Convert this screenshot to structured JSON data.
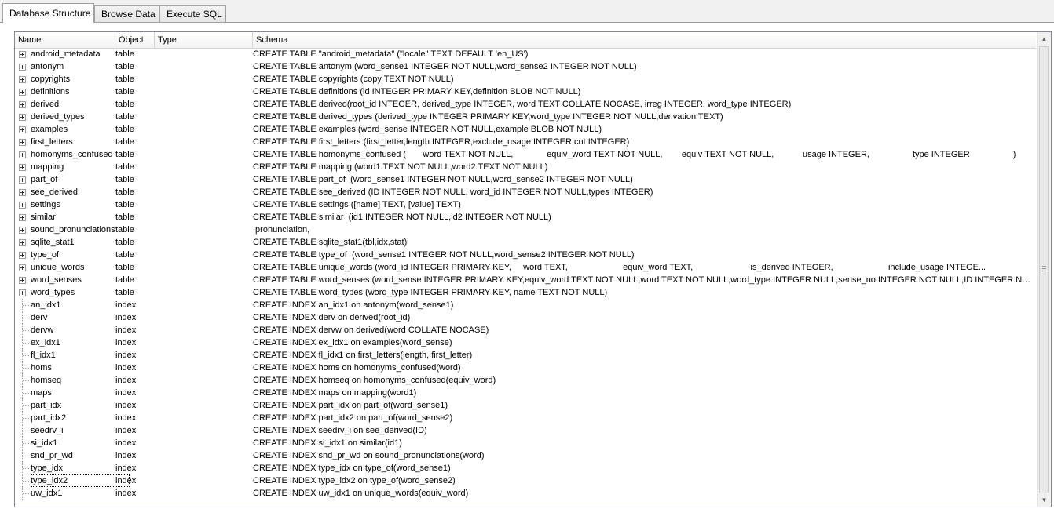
{
  "tabs": [
    {
      "label": "Database Structure",
      "active": true
    },
    {
      "label": "Browse Data",
      "active": false
    },
    {
      "label": "Execute SQL",
      "active": false
    }
  ],
  "columns": {
    "name": "Name",
    "object": "Object",
    "type": "Type",
    "schema": "Schema"
  },
  "rows": [
    {
      "name": "android_metadata",
      "object": "table",
      "type": "",
      "schema": "CREATE TABLE \"android_metadata\" (\"locale\" TEXT DEFAULT 'en_US')",
      "expandable": true
    },
    {
      "name": "antonym",
      "object": "table",
      "type": "",
      "schema": "CREATE TABLE antonym (word_sense1 INTEGER NOT NULL,word_sense2 INTEGER NOT NULL)",
      "expandable": true
    },
    {
      "name": "copyrights",
      "object": "table",
      "type": "",
      "schema": "CREATE TABLE copyrights (copy TEXT NOT NULL)",
      "expandable": true
    },
    {
      "name": "definitions",
      "object": "table",
      "type": "",
      "schema": "CREATE TABLE definitions (id INTEGER PRIMARY KEY,definition BLOB NOT NULL)",
      "expandable": true
    },
    {
      "name": "derived",
      "object": "table",
      "type": "",
      "schema": "CREATE TABLE derived(root_id INTEGER, derived_type INTEGER, word TEXT COLLATE NOCASE, irreg INTEGER, word_type INTEGER)",
      "expandable": true
    },
    {
      "name": "derived_types",
      "object": "table",
      "type": "",
      "schema": "CREATE TABLE derived_types (derived_type INTEGER PRIMARY KEY,word_type INTEGER NOT NULL,derivation TEXT)",
      "expandable": true
    },
    {
      "name": "examples",
      "object": "table",
      "type": "",
      "schema": "CREATE TABLE examples (word_sense INTEGER NOT NULL,example BLOB NOT NULL)",
      "expandable": true
    },
    {
      "name": "first_letters",
      "object": "table",
      "type": "",
      "schema": "CREATE TABLE first_letters (first_letter,length INTEGER,exclude_usage INTEGER,cnt INTEGER)",
      "expandable": true
    },
    {
      "name": "homonyms_confused",
      "object": "table",
      "type": "",
      "schema": "CREATE TABLE homonyms_confused (       word TEXT NOT NULL,              equiv_word TEXT NOT NULL,        equiv TEXT NOT NULL,            usage INTEGER,                  type INTEGER                  )",
      "expandable": true
    },
    {
      "name": "mapping",
      "object": "table",
      "type": "",
      "schema": "CREATE TABLE mapping (word1 TEXT NOT NULL,word2 TEXT NOT NULL)",
      "expandable": true
    },
    {
      "name": "part_of",
      "object": "table",
      "type": "",
      "schema": "CREATE TABLE part_of  (word_sense1 INTEGER NOT NULL,word_sense2 INTEGER NOT NULL)",
      "expandable": true
    },
    {
      "name": "see_derived",
      "object": "table",
      "type": "",
      "schema": "CREATE TABLE see_derived (ID INTEGER NOT NULL, word_id INTEGER NOT NULL,types INTEGER)",
      "expandable": true
    },
    {
      "name": "settings",
      "object": "table",
      "type": "",
      "schema": "CREATE TABLE settings ([name] TEXT, [value] TEXT)",
      "expandable": true
    },
    {
      "name": "similar",
      "object": "table",
      "type": "",
      "schema": "CREATE TABLE similar  (id1 INTEGER NOT NULL,id2 INTEGER NOT NULL)",
      "expandable": true
    },
    {
      "name": "sound_pronunciations",
      "object": "table",
      "type": "",
      "schema": " pronunciation,",
      "expandable": true
    },
    {
      "name": "sqlite_stat1",
      "object": "table",
      "type": "",
      "schema": "CREATE TABLE sqlite_stat1(tbl,idx,stat)",
      "expandable": true
    },
    {
      "name": "type_of",
      "object": "table",
      "type": "",
      "schema": "CREATE TABLE type_of  (word_sense1 INTEGER NOT NULL,word_sense2 INTEGER NOT NULL)",
      "expandable": true
    },
    {
      "name": "unique_words",
      "object": "table",
      "type": "",
      "schema": "CREATE TABLE unique_words (word_id INTEGER PRIMARY KEY,     word TEXT,                       equiv_word TEXT,                        is_derived INTEGER,                       include_usage INTEGE...",
      "expandable": true
    },
    {
      "name": "word_senses",
      "object": "table",
      "type": "",
      "schema": "CREATE TABLE word_senses (word_sense INTEGER PRIMARY KEY,equiv_word TEXT NOT NULL,word TEXT NOT NULL,word_type INTEGER NULL,sense_no INTEGER NOT NULL,ID INTEGER NOT ...",
      "expandable": true
    },
    {
      "name": "word_types",
      "object": "table",
      "type": "",
      "schema": "CREATE TABLE word_types (word_type INTEGER PRIMARY KEY, name TEXT NOT NULL)",
      "expandable": true
    },
    {
      "name": "an_idx1",
      "object": "index",
      "type": "",
      "schema": "CREATE INDEX an_idx1 on antonym(word_sense1)",
      "expandable": false
    },
    {
      "name": "derv",
      "object": "index",
      "type": "",
      "schema": "CREATE INDEX derv on derived(root_id)",
      "expandable": false
    },
    {
      "name": "dervw",
      "object": "index",
      "type": "",
      "schema": "CREATE INDEX dervw on derived(word COLLATE NOCASE)",
      "expandable": false
    },
    {
      "name": "ex_idx1",
      "object": "index",
      "type": "",
      "schema": "CREATE INDEX ex_idx1 on examples(word_sense)",
      "expandable": false
    },
    {
      "name": "fl_idx1",
      "object": "index",
      "type": "",
      "schema": "CREATE INDEX fl_idx1 on first_letters(length, first_letter)",
      "expandable": false
    },
    {
      "name": "homs",
      "object": "index",
      "type": "",
      "schema": "CREATE INDEX homs on homonyms_confused(word)",
      "expandable": false
    },
    {
      "name": "homseq",
      "object": "index",
      "type": "",
      "schema": "CREATE INDEX homseq on homonyms_confused(equiv_word)",
      "expandable": false
    },
    {
      "name": "maps",
      "object": "index",
      "type": "",
      "schema": "CREATE INDEX maps on mapping(word1)",
      "expandable": false
    },
    {
      "name": "part_idx",
      "object": "index",
      "type": "",
      "schema": "CREATE INDEX part_idx on part_of(word_sense1)",
      "expandable": false
    },
    {
      "name": "part_idx2",
      "object": "index",
      "type": "",
      "schema": "CREATE INDEX part_idx2 on part_of(word_sense2)",
      "expandable": false
    },
    {
      "name": "seedrv_i",
      "object": "index",
      "type": "",
      "schema": "CREATE INDEX seedrv_i on see_derived(ID)",
      "expandable": false
    },
    {
      "name": "si_idx1",
      "object": "index",
      "type": "",
      "schema": "CREATE INDEX si_idx1 on similar(id1)",
      "expandable": false
    },
    {
      "name": "snd_pr_wd",
      "object": "index",
      "type": "",
      "schema": "CREATE INDEX snd_pr_wd on sound_pronunciations(word)",
      "expandable": false
    },
    {
      "name": "type_idx",
      "object": "index",
      "type": "",
      "schema": "CREATE INDEX type_idx on type_of(word_sense1)",
      "expandable": false
    },
    {
      "name": "type_idx2",
      "object": "index",
      "type": "",
      "schema": "CREATE INDEX type_idx2 on type_of(word_sense2)",
      "expandable": false,
      "focused": true
    },
    {
      "name": "uw_idx1",
      "object": "index",
      "type": "",
      "schema": "CREATE INDEX uw_idx1 on unique_words(equiv_word)",
      "expandable": false
    }
  ],
  "scrollbar": {
    "up_icon": "scroll-up-arrow-icon",
    "down_icon": "scroll-down-arrow-icon"
  }
}
